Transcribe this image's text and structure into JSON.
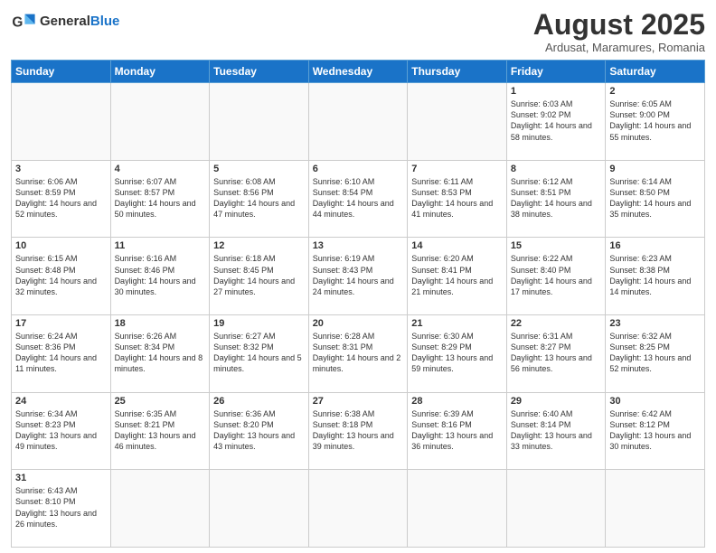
{
  "header": {
    "logo_general": "General",
    "logo_blue": "Blue",
    "title": "August 2025",
    "subtitle": "Ardusat, Maramures, Romania"
  },
  "weekdays": [
    "Sunday",
    "Monday",
    "Tuesday",
    "Wednesday",
    "Thursday",
    "Friday",
    "Saturday"
  ],
  "weeks": [
    [
      {
        "day": "",
        "info": ""
      },
      {
        "day": "",
        "info": ""
      },
      {
        "day": "",
        "info": ""
      },
      {
        "day": "",
        "info": ""
      },
      {
        "day": "",
        "info": ""
      },
      {
        "day": "1",
        "info": "Sunrise: 6:03 AM\nSunset: 9:02 PM\nDaylight: 14 hours and 58 minutes."
      },
      {
        "day": "2",
        "info": "Sunrise: 6:05 AM\nSunset: 9:00 PM\nDaylight: 14 hours and 55 minutes."
      }
    ],
    [
      {
        "day": "3",
        "info": "Sunrise: 6:06 AM\nSunset: 8:59 PM\nDaylight: 14 hours and 52 minutes."
      },
      {
        "day": "4",
        "info": "Sunrise: 6:07 AM\nSunset: 8:57 PM\nDaylight: 14 hours and 50 minutes."
      },
      {
        "day": "5",
        "info": "Sunrise: 6:08 AM\nSunset: 8:56 PM\nDaylight: 14 hours and 47 minutes."
      },
      {
        "day": "6",
        "info": "Sunrise: 6:10 AM\nSunset: 8:54 PM\nDaylight: 14 hours and 44 minutes."
      },
      {
        "day": "7",
        "info": "Sunrise: 6:11 AM\nSunset: 8:53 PM\nDaylight: 14 hours and 41 minutes."
      },
      {
        "day": "8",
        "info": "Sunrise: 6:12 AM\nSunset: 8:51 PM\nDaylight: 14 hours and 38 minutes."
      },
      {
        "day": "9",
        "info": "Sunrise: 6:14 AM\nSunset: 8:50 PM\nDaylight: 14 hours and 35 minutes."
      }
    ],
    [
      {
        "day": "10",
        "info": "Sunrise: 6:15 AM\nSunset: 8:48 PM\nDaylight: 14 hours and 32 minutes."
      },
      {
        "day": "11",
        "info": "Sunrise: 6:16 AM\nSunset: 8:46 PM\nDaylight: 14 hours and 30 minutes."
      },
      {
        "day": "12",
        "info": "Sunrise: 6:18 AM\nSunset: 8:45 PM\nDaylight: 14 hours and 27 minutes."
      },
      {
        "day": "13",
        "info": "Sunrise: 6:19 AM\nSunset: 8:43 PM\nDaylight: 14 hours and 24 minutes."
      },
      {
        "day": "14",
        "info": "Sunrise: 6:20 AM\nSunset: 8:41 PM\nDaylight: 14 hours and 21 minutes."
      },
      {
        "day": "15",
        "info": "Sunrise: 6:22 AM\nSunset: 8:40 PM\nDaylight: 14 hours and 17 minutes."
      },
      {
        "day": "16",
        "info": "Sunrise: 6:23 AM\nSunset: 8:38 PM\nDaylight: 14 hours and 14 minutes."
      }
    ],
    [
      {
        "day": "17",
        "info": "Sunrise: 6:24 AM\nSunset: 8:36 PM\nDaylight: 14 hours and 11 minutes."
      },
      {
        "day": "18",
        "info": "Sunrise: 6:26 AM\nSunset: 8:34 PM\nDaylight: 14 hours and 8 minutes."
      },
      {
        "day": "19",
        "info": "Sunrise: 6:27 AM\nSunset: 8:32 PM\nDaylight: 14 hours and 5 minutes."
      },
      {
        "day": "20",
        "info": "Sunrise: 6:28 AM\nSunset: 8:31 PM\nDaylight: 14 hours and 2 minutes."
      },
      {
        "day": "21",
        "info": "Sunrise: 6:30 AM\nSunset: 8:29 PM\nDaylight: 13 hours and 59 minutes."
      },
      {
        "day": "22",
        "info": "Sunrise: 6:31 AM\nSunset: 8:27 PM\nDaylight: 13 hours and 56 minutes."
      },
      {
        "day": "23",
        "info": "Sunrise: 6:32 AM\nSunset: 8:25 PM\nDaylight: 13 hours and 52 minutes."
      }
    ],
    [
      {
        "day": "24",
        "info": "Sunrise: 6:34 AM\nSunset: 8:23 PM\nDaylight: 13 hours and 49 minutes."
      },
      {
        "day": "25",
        "info": "Sunrise: 6:35 AM\nSunset: 8:21 PM\nDaylight: 13 hours and 46 minutes."
      },
      {
        "day": "26",
        "info": "Sunrise: 6:36 AM\nSunset: 8:20 PM\nDaylight: 13 hours and 43 minutes."
      },
      {
        "day": "27",
        "info": "Sunrise: 6:38 AM\nSunset: 8:18 PM\nDaylight: 13 hours and 39 minutes."
      },
      {
        "day": "28",
        "info": "Sunrise: 6:39 AM\nSunset: 8:16 PM\nDaylight: 13 hours and 36 minutes."
      },
      {
        "day": "29",
        "info": "Sunrise: 6:40 AM\nSunset: 8:14 PM\nDaylight: 13 hours and 33 minutes."
      },
      {
        "day": "30",
        "info": "Sunrise: 6:42 AM\nSunset: 8:12 PM\nDaylight: 13 hours and 30 minutes."
      }
    ],
    [
      {
        "day": "31",
        "info": "Sunrise: 6:43 AM\nSunset: 8:10 PM\nDaylight: 13 hours and 26 minutes."
      },
      {
        "day": "",
        "info": ""
      },
      {
        "day": "",
        "info": ""
      },
      {
        "day": "",
        "info": ""
      },
      {
        "day": "",
        "info": ""
      },
      {
        "day": "",
        "info": ""
      },
      {
        "day": "",
        "info": ""
      }
    ]
  ]
}
